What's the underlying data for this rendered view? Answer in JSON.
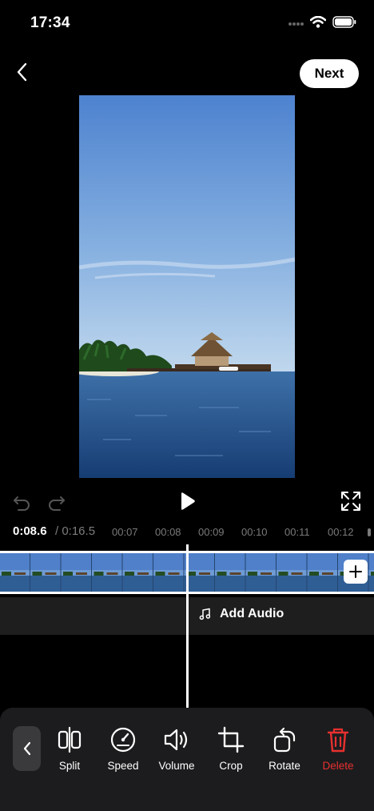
{
  "status_bar": {
    "time": "17:34",
    "icons": [
      "signal-icon",
      "wifi-icon",
      "battery-icon"
    ]
  },
  "nav": {
    "next_label": "Next"
  },
  "player": {
    "current_time": "0:08.6",
    "total_time": "/ 0:16.5",
    "ticks": [
      "00:07",
      "00:08",
      "00:09",
      "00:10",
      "00:11",
      "00:12"
    ]
  },
  "audio": {
    "add_audio_label": "Add Audio"
  },
  "toolbar": {
    "tools": [
      {
        "label": "Split",
        "icon": "split-icon"
      },
      {
        "label": "Speed",
        "icon": "speedometer-icon"
      },
      {
        "label": "Volume",
        "icon": "volume-icon"
      },
      {
        "label": "Crop",
        "icon": "crop-icon"
      },
      {
        "label": "Rotate",
        "icon": "rotate-icon"
      },
      {
        "label": "Delete",
        "icon": "trash-icon"
      }
    ]
  },
  "colors": {
    "background": "#000000",
    "toolbar": "#1c1c1e",
    "danger": "#e8302f",
    "accent_button": "#ffffff"
  }
}
